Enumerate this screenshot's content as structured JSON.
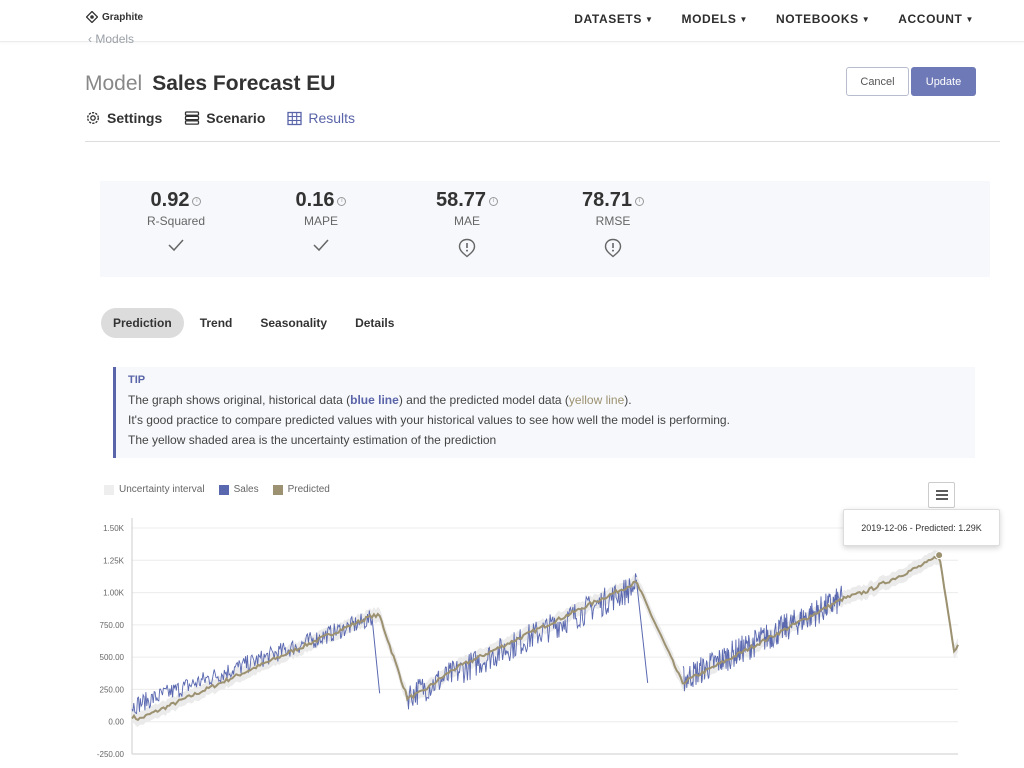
{
  "app": {
    "logo_text": "Graphite"
  },
  "nav": {
    "items": [
      {
        "label": "DATASETS"
      },
      {
        "label": "MODELS"
      },
      {
        "label": "NOTEBOOKS"
      },
      {
        "label": "ACCOUNT"
      }
    ]
  },
  "breadcrumb": {
    "back_label": "Models"
  },
  "header": {
    "prefix": "Model",
    "name": "Sales Forecast EU",
    "cancel_label": "Cancel",
    "update_label": "Update"
  },
  "subtabs": [
    {
      "label": "Settings",
      "icon": "gear-icon"
    },
    {
      "label": "Scenario",
      "icon": "layers-icon"
    },
    {
      "label": "Results",
      "icon": "table-icon",
      "active": true
    }
  ],
  "metrics": [
    {
      "value": "0.92",
      "label": "R-Squared",
      "status": "check-icon"
    },
    {
      "value": "0.16",
      "label": "MAPE",
      "status": "check-icon"
    },
    {
      "value": "58.77",
      "label": "MAE",
      "status": "alert-icon"
    },
    {
      "value": "78.71",
      "label": "RMSE",
      "status": "alert-icon"
    }
  ],
  "chart_tabs": [
    {
      "label": "Prediction",
      "active": true
    },
    {
      "label": "Trend"
    },
    {
      "label": "Seasonality"
    },
    {
      "label": "Details"
    }
  ],
  "tip": {
    "title": "TIP",
    "line1_a": "The graph shows original, historical data (",
    "line1_blue": "blue line",
    "line1_b": ") and the predicted model data (",
    "line1_yellow": "yellow line",
    "line1_c": ").",
    "line2": "It's good practice to compare predicted values with your historical values to see how well the model is performing.",
    "line3": "The yellow shaded area is the uncertainty estimation of the prediction"
  },
  "colors": {
    "accent": "#5a64a8",
    "sales": "#5a68b0",
    "predicted": "#9c9170",
    "uncertainty": "#e6e6e6"
  },
  "chart_data": {
    "type": "line",
    "legend": [
      "Uncertainty interval",
      "Sales",
      "Predicted"
    ],
    "legend_position": "top-left",
    "ylim": [
      -250,
      1500
    ],
    "yticks": [
      "1.50K",
      "1.25K",
      "1.00K",
      "750.00",
      "500.00",
      "250.00",
      "0.00",
      "-250.00"
    ],
    "ytick_values": [
      1500,
      1250,
      1000,
      750,
      500,
      250,
      0,
      -250
    ],
    "x_start": "2017-01-01",
    "x_end": "2019-12-31",
    "tooltip": "2019-12-06 - Predicted: 1.29K",
    "predicted_knots": [
      [
        "2017-01-01",
        40
      ],
      [
        "2017-01-10",
        20
      ],
      [
        "2017-11-15",
        820
      ],
      [
        "2017-11-25",
        820
      ],
      [
        "2018-01-01",
        180
      ],
      [
        "2018-01-20",
        230
      ],
      [
        "2018-03-01",
        400
      ],
      [
        "2018-10-31",
        1080
      ],
      [
        "2018-12-31",
        300
      ],
      [
        "2019-01-20",
        360
      ],
      [
        "2019-03-01",
        480
      ],
      [
        "2019-07-31",
        950
      ],
      [
        "2019-09-01",
        1010
      ],
      [
        "2019-11-20",
        1230
      ],
      [
        "2019-12-06",
        1290
      ],
      [
        "2019-12-26",
        550
      ],
      [
        "2019-12-31",
        600
      ]
    ],
    "sales_segments": [
      {
        "from": "2017-01-01",
        "to": "2017-11-15",
        "start": 120,
        "end": 800,
        "noise": 70
      },
      {
        "from": "2018-01-01",
        "to": "2018-10-31",
        "start": 200,
        "end": 1050,
        "noise": 110
      },
      {
        "from": "2019-01-01",
        "to": "2019-07-31",
        "start": 330,
        "end": 950,
        "noise": 110
      }
    ]
  }
}
